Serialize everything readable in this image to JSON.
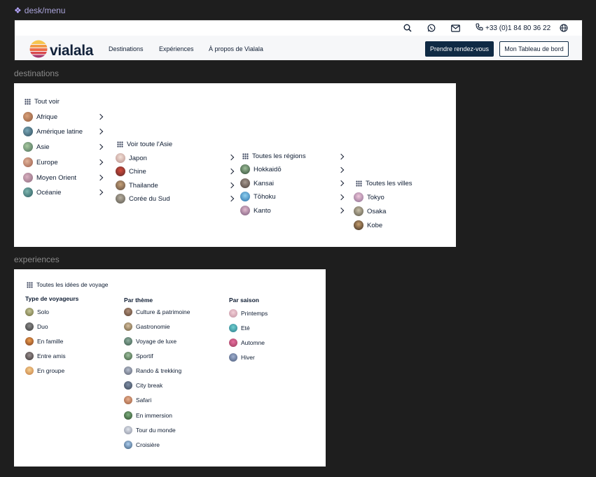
{
  "frame_title": "desk/menu",
  "header": {
    "phone": "+33 (0)1 84 80 36 22",
    "logo_text": "vialala",
    "nav": [
      "Destinations",
      "Expériences",
      "À propos de Vialala"
    ],
    "cta_primary": "Prendre rendez-vous",
    "cta_secondary": "Mon Tableau de bord",
    "icons": [
      "search-icon",
      "whatsapp-icon",
      "mail-icon",
      "phone-icon",
      "globe-icon"
    ]
  },
  "destinations": {
    "section_label": "destinations",
    "continents": {
      "see_all": "Tout voir",
      "items": [
        "Afrique",
        "Amérique latine",
        "Asie",
        "Europe",
        "Moyen Orient",
        "Océanie"
      ]
    },
    "countries": {
      "see_all": "Voir toute l'Asie",
      "items": [
        "Japon",
        "Chine",
        "Thailande",
        "Corée du Sud"
      ]
    },
    "regions": {
      "see_all": "Toutes les régions",
      "items": [
        "Hokkaidō",
        "Kansai",
        "Tōhoku",
        "Kanto"
      ]
    },
    "cities": {
      "see_all": "Toutes les villes",
      "items": [
        "Tokyo",
        "Osaka",
        "Kobe"
      ]
    }
  },
  "experiences": {
    "section_label": "experiences",
    "see_all": "Toutes les idées de voyage",
    "travelers": {
      "heading": "Type de voyageurs",
      "items": [
        "Solo",
        "Duo",
        "En famille",
        "Entre amis",
        "En groupe"
      ]
    },
    "themes": {
      "heading": "Par thème",
      "items": [
        "Culture & patrimoine",
        "Gastronomie",
        "Voyage de luxe",
        "Sportif",
        "Rando & trekking",
        "City break",
        "Safari",
        "En immersion",
        "Tour du monde",
        "Croisière"
      ]
    },
    "seasons": {
      "heading": "Par saison",
      "items": [
        "Printemps",
        "Eté",
        "Automne",
        "Hiver"
      ]
    }
  },
  "colors": {
    "brand_dark": "#0f2a44",
    "logo_gradient": [
      "#f4b04a",
      "#e9624a",
      "#b83c6e"
    ]
  }
}
